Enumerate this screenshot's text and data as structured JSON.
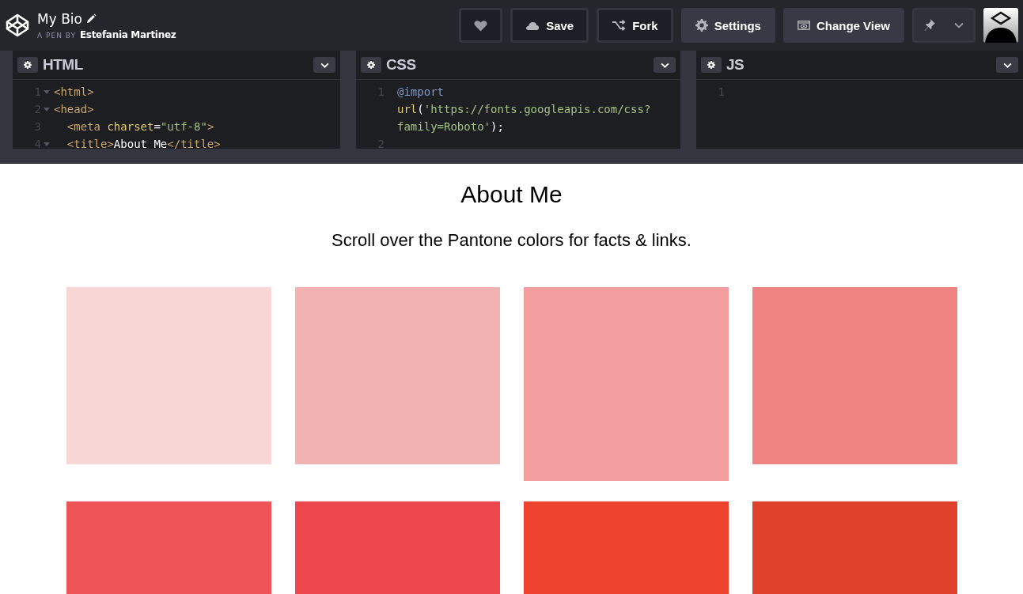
{
  "header": {
    "title": "My Bio",
    "byline_prefix": "A PEN BY",
    "author": "Estefania Martinez",
    "buttons": [
      {
        "kind": "outline"
      },
      {
        "label": "Save",
        "kind": "outline"
      },
      {
        "label": "Fork",
        "kind": "outline"
      },
      {
        "label": "Settings",
        "kind": "filled"
      },
      {
        "label": "Change View",
        "kind": "filled"
      }
    ]
  },
  "editors": [
    {
      "title": "HTML",
      "lines": [
        {
          "number": "1",
          "foldable": true,
          "tokens": [
            {
              "kind": "tag",
              "text": "<html>"
            }
          ]
        },
        {
          "number": "2",
          "foldable": true,
          "tokens": [
            {
              "kind": "tag",
              "text": "<head>"
            }
          ]
        },
        {
          "number": "3",
          "foldable": false,
          "tokens": [
            {
              "kind": "tag",
              "text": "  <meta "
            },
            {
              "kind": "attr",
              "text": "charset"
            },
            {
              "kind": "text",
              "text": "="
            },
            {
              "kind": "string",
              "text": "\"utf-8\""
            },
            {
              "kind": "tag",
              "text": ">"
            }
          ]
        },
        {
          "number": "4",
          "foldable": true,
          "tokens": [
            {
              "kind": "tag",
              "text": "  <title>"
            },
            {
              "kind": "text",
              "text": "About Me"
            },
            {
              "kind": "tag",
              "text": "</title>"
            }
          ]
        }
      ]
    },
    {
      "title": "CSS",
      "lines": [
        {
          "number": "1",
          "foldable": false,
          "tokens": [
            {
              "kind": "keyword",
              "text": "@import"
            }
          ]
        },
        {
          "tokens": [
            {
              "kind": "attr",
              "text": "url"
            },
            {
              "kind": "text",
              "text": "("
            },
            {
              "kind": "string",
              "text": "'https://fonts.googleapis.com/css?"
            }
          ]
        },
        {
          "tokens": [
            {
              "kind": "string",
              "text": "family=Roboto'"
            },
            {
              "kind": "text",
              "text": ");"
            }
          ]
        },
        {
          "number": "2",
          "foldable": false
        }
      ]
    },
    {
      "title": "JS",
      "lines": [
        {
          "number": "1",
          "foldable": false
        }
      ]
    }
  ],
  "preview": {
    "heading": "About Me",
    "subtitle": "Scroll over the Pantone colors for facts & links.",
    "swatches": [
      {
        "color": "#f7d6d5",
        "tall": false
      },
      {
        "color": "#f3b2b2",
        "tall": false
      },
      {
        "color": "#f29d9e",
        "tall": true
      },
      {
        "color": "#ef8482",
        "tall": false
      },
      {
        "color": "#ee5458"
      },
      {
        "color": "#ee474d"
      },
      {
        "color": "#ee432e"
      },
      {
        "color": "#df412c"
      }
    ]
  }
}
